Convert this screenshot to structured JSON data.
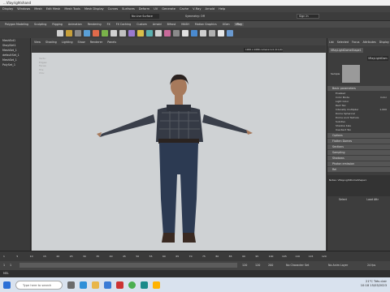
{
  "window": {
    "title": "...Vlayrightshand",
    "workspace": "Workspace"
  },
  "menus": [
    "Display",
    "Windows",
    "Mesh",
    "Edit Mesh",
    "Mesh Tools",
    "Mesh Display",
    "Curves",
    "Surfaces",
    "Deform",
    "UV",
    "Generate",
    "Cache",
    "V-Ray",
    "Arnold",
    "Help"
  ],
  "status": {
    "live_surface": "No Live Surface",
    "symmetry": "Symmetry: Off",
    "sign_in": "Sign In"
  },
  "shelf_tabs": [
    "Polygon Modeling",
    "Sculpting",
    "Rigging",
    "Animation",
    "Rendering",
    "FX",
    "FX Caching",
    "Custom",
    "Arnold",
    "Bifrost",
    "MASH",
    "Motion Graphics",
    "XGen",
    "VRay"
  ],
  "active_shelf": "VRay",
  "outliner": {
    "items": [
      "MeshExt1",
      "ShaylSet1",
      "MeshSet_1",
      "defaultSet_1",
      "MeshSet_1",
      "PolySet_1"
    ]
  },
  "viewport": {
    "menu": [
      "View",
      "Shading",
      "Lighting",
      "Show",
      "Renderer",
      "Panels"
    ],
    "resolution": "1920 x 1080 camera:1x1 (0:1/0)",
    "hud": [
      [
        "Verts:",
        "",
        "",
        ""
      ],
      [
        "Edges:",
        "",
        "",
        ""
      ],
      [
        "Faces:",
        "",
        "",
        ""
      ],
      [
        "Tris:",
        "",
        "",
        ""
      ],
      [
        "UVs:",
        "",
        "",
        ""
      ]
    ]
  },
  "attribute_editor": {
    "tabs": [
      "List",
      "Selected",
      "Focus",
      "Attributes",
      "Display"
    ],
    "node_tab": "VRayLightDomeShape1",
    "node_field": "VRayLightDom",
    "sample_label": "Sample",
    "sections": {
      "basic": "Basic parameters",
      "options": "Options"
    },
    "rows": [
      [
        "Enabled",
        ""
      ],
      [
        "Color Mode",
        "Color"
      ],
      [
        "Light Color",
        ""
      ],
      [
        "Rect Tex",
        ""
      ],
      [
        "Intensity multiplier",
        "1.000"
      ],
      [
        "Dome Spherical",
        ""
      ],
      [
        "Dome Lock Texture",
        ""
      ],
      [
        "Subdivs",
        ""
      ],
      [
        "Shadow bias",
        ""
      ],
      [
        "Use Rect Tex",
        ""
      ]
    ],
    "collapsed": [
      "Flatten Domes",
      "Sections",
      "Sampling",
      "Shadows",
      "Photon emission",
      "Rel"
    ],
    "notes_label": "Notes: VRayLightDomeShape1",
    "select_btn": "Select",
    "load_btn": "Load Attr"
  },
  "timeline": {
    "ticks": [
      "1",
      "5",
      "10",
      "15",
      "20",
      "25",
      "30",
      "35",
      "40",
      "45",
      "50",
      "55",
      "60",
      "65",
      "70",
      "75",
      "80",
      "85",
      "90",
      "95",
      "100",
      "105",
      "110",
      "115",
      "120"
    ],
    "start": "1",
    "end": "1",
    "range_start": "1",
    "range_end": "120",
    "current": "120",
    "playback_end": "200",
    "character_set": "No Character Set",
    "anim_layer": "No Anim Layer",
    "fps": "24 fps"
  },
  "cmd": {
    "label": "MEL"
  },
  "taskbar": {
    "search_placeholder": "Type here to search",
    "weather": "21°C  Très clair",
    "time": "10:18",
    "date": "15/03/2023"
  }
}
